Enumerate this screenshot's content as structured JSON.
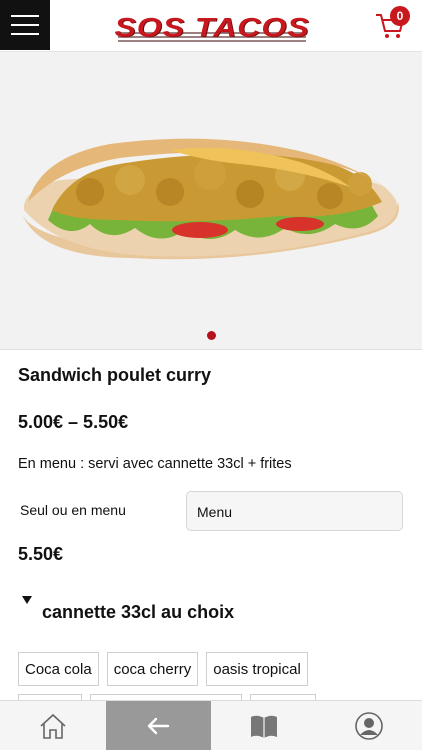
{
  "header": {
    "menu_icon": "hamburger-icon",
    "logo_text": "SOS TACOS",
    "cart_icon": "shopping-cart-icon",
    "cart_count": "0",
    "brand_color": "#c8171d"
  },
  "hero": {
    "image": "sandwich-poulet-curry-photo",
    "active_slide_color": "#b5121b"
  },
  "product": {
    "title": "Sandwich poulet curry",
    "price_range": "5.00€ – 5.50€",
    "description": "En menu : servi avec cannette 33cl + frites",
    "option_label": "Seul ou en menu",
    "option_selected": "Menu",
    "price": "5.50€"
  },
  "addon": {
    "title": "cannette 33cl au choix",
    "choices": [
      "Coca cola",
      "coca cherry",
      "oasis tropical"
    ]
  },
  "tabbar": {
    "items": [
      {
        "icon": "home-icon"
      },
      {
        "icon": "back-arrow-icon"
      },
      {
        "icon": "book-icon"
      },
      {
        "icon": "user-icon"
      }
    ],
    "active_color": "#999999"
  }
}
